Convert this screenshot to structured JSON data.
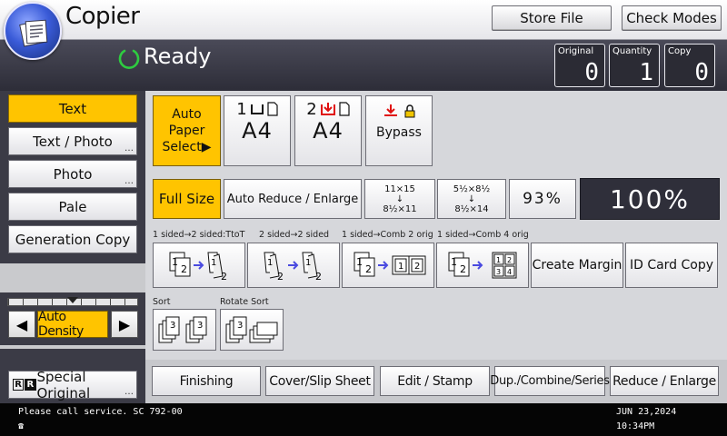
{
  "header": {
    "app_title": "Copier",
    "store_file": "Store File",
    "check_modes": "Check Modes"
  },
  "status": {
    "text": "Ready",
    "counters": [
      {
        "label": "Original",
        "value": "0"
      },
      {
        "label": "Quantity",
        "value": "1"
      },
      {
        "label": "Copy",
        "value": "0"
      }
    ]
  },
  "original_type": {
    "items": [
      {
        "label": "Text",
        "selected": true
      },
      {
        "label": "Text / Photo",
        "selected": false
      },
      {
        "label": "Photo",
        "selected": false
      },
      {
        "label": "Pale",
        "selected": false
      },
      {
        "label": "Generation Copy",
        "selected": false
      }
    ]
  },
  "density": {
    "label": "Auto Density",
    "left_arrow": "◀",
    "right_arrow": "▶"
  },
  "special_original": {
    "label": "Special Original"
  },
  "paper": {
    "auto_select_line1": "Auto Paper",
    "auto_select_line2": "Select▶",
    "tray1": {
      "number": "1",
      "size": "A4"
    },
    "tray2": {
      "number": "2",
      "size": "A4"
    },
    "bypass": "Bypass"
  },
  "reduce_enlarge": {
    "full_size": "Full Size",
    "auto_reduce": "Auto Reduce / Enlarge",
    "ratio1_top": "11×15",
    "ratio1_arrow": "↓",
    "ratio1_bottom": "8½×11",
    "ratio2_top": "5½×8½",
    "ratio2_arrow": "↓",
    "ratio2_bottom": "8½×14",
    "preset_pct": "93%",
    "current_ratio": "100%"
  },
  "duplex": {
    "labels": [
      "1 sided→2 sided:TtoT",
      "2 sided→2 sided",
      "1 sided→Comb 2 orig",
      "1 sided→Comb 4 orig"
    ],
    "create_margin": "Create Margin",
    "id_card_copy": "ID Card Copy"
  },
  "sort": {
    "sort_label": "Sort",
    "rotate_sort_label": "Rotate Sort"
  },
  "tabs": [
    "Finishing",
    "Cover/Slip Sheet",
    "Edit / Stamp",
    "Dup./Combine/Series",
    "Reduce / Enlarge"
  ],
  "footer": {
    "message": "Please call service. SC 792-00",
    "date": "JUN  23,2024",
    "time": "10:34PM"
  },
  "colors": {
    "selected": "#ffc400",
    "ready_ring": "#2ecc40",
    "panel_dark": "#3b3b46",
    "status_bg": "#2d2d38"
  }
}
